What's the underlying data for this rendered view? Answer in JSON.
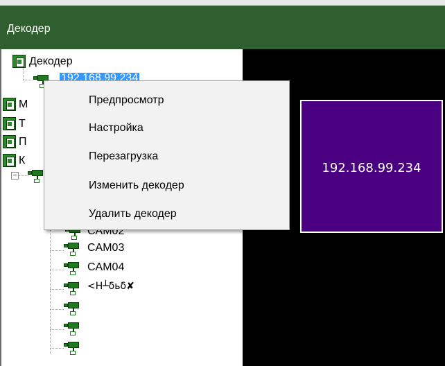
{
  "window": {
    "title": "Декодер"
  },
  "tree": {
    "root_label": "Декодер",
    "selected_label": "192.168.99.234",
    "partial_nodes": [
      "М",
      "Т",
      "П",
      "К"
    ],
    "partial_cam": "CAM02",
    "cameras": [
      "CAM03",
      "CAM04",
      "<H┴δьδ✘"
    ]
  },
  "preview": {
    "ip": "192.168.99.234",
    "background": "#4b0082"
  },
  "context_menu": {
    "items": [
      "Предпросмотр",
      "Настройка",
      "Перезагрузка",
      "Изменить декодер",
      "Удалить декодер"
    ]
  },
  "colors": {
    "titlebar": "#2f5f2f",
    "accent_green": "#1f7a1f",
    "selection": "#3399ff"
  }
}
